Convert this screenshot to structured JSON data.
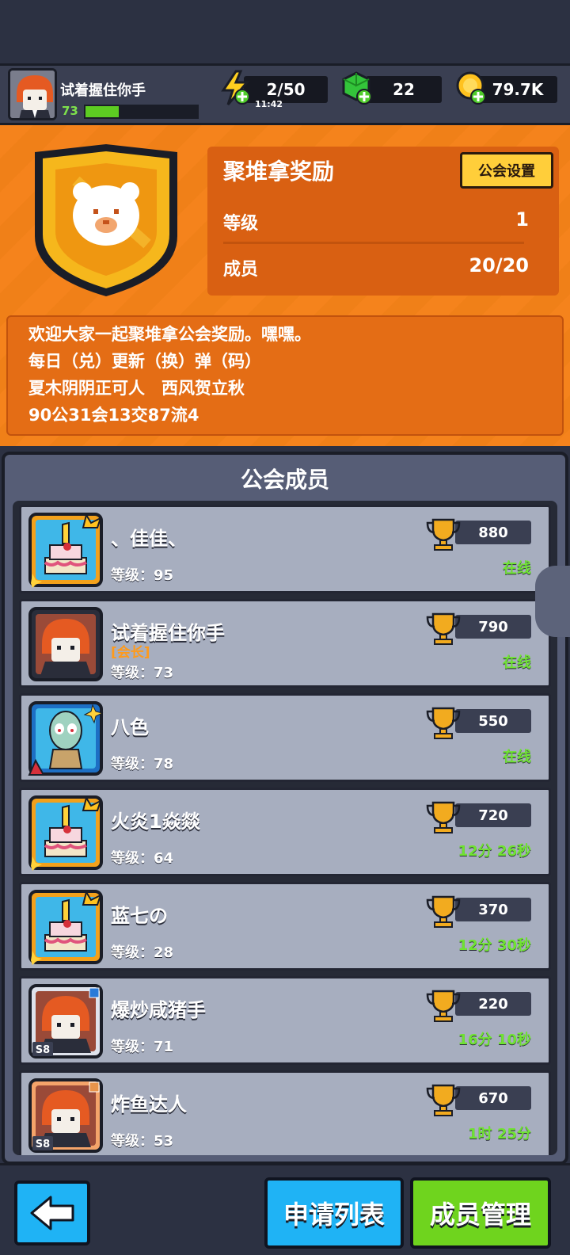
{
  "player": {
    "name": "试着握住你手",
    "level": "73",
    "xp_fraction": 0.3
  },
  "resources": {
    "energy": "2/50",
    "energy_timer": "11:42",
    "gems": "22",
    "coins": "79.7K"
  },
  "guild": {
    "name": "聚堆拿奖励",
    "settings_label": "公会设置",
    "level_label": "等级",
    "level_value": "1",
    "members_label": "成员",
    "members_value": "20/20",
    "description": [
      "欢迎大家一起聚堆拿公会奖励。嘿嘿。",
      "每日（兑）更新（换）弹（码）",
      "夏木阴阴正可人　西风贺立秋",
      "90公31会13交87流4"
    ]
  },
  "members_title": "公会成员",
  "members": [
    {
      "name": "、佳佳、",
      "role": "",
      "level": "等级：95",
      "score": "880",
      "status": "在线",
      "avatar": "cake"
    },
    {
      "name": "试着握住你手",
      "role": "[会长]",
      "level": "等级：73",
      "score": "790",
      "status": "在线",
      "avatar": "redhead"
    },
    {
      "name": "八色",
      "role": "",
      "level": "等级：78",
      "score": "550",
      "status": "在线",
      "avatar": "squid"
    },
    {
      "name": "火炎1焱燚",
      "role": "",
      "level": "等级：64",
      "score": "720",
      "status": "12分 26秒",
      "avatar": "cake"
    },
    {
      "name": "蓝七の",
      "role": "",
      "level": "等级：28",
      "score": "370",
      "status": "12分 30秒",
      "avatar": "cake"
    },
    {
      "name": "爆炒咸猪手",
      "role": "",
      "level": "等级：71",
      "score": "220",
      "status": "16分 10秒",
      "avatar": "redhead-s8-blue",
      "badge": "S8"
    },
    {
      "name": "炸鱼达人",
      "role": "",
      "level": "等级：53",
      "score": "670",
      "status": "1时 25分",
      "avatar": "redhead-s8-orange",
      "badge": "S8"
    }
  ],
  "buttons": {
    "applications": "申请列表",
    "manage_members": "成员管理"
  },
  "colors": {
    "orange": "#f5831c",
    "online_green": "#6fe332",
    "settings_yellow": "#ffce3a",
    "apply_blue": "#1fb3f5",
    "manage_green": "#6fd41e"
  }
}
